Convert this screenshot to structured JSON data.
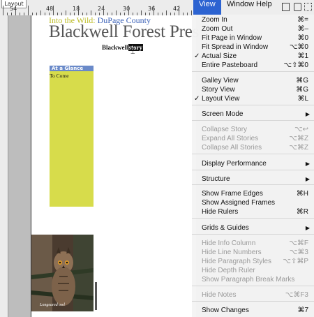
{
  "document": {
    "tab_label": "Layout",
    "ruler_numbers": [
      "54",
      "48",
      "18",
      "24",
      "30",
      "36",
      "42"
    ],
    "subhead_left": "Into the Wild:",
    "subhead_right": "DuPage County",
    "masthead": "Blackwell Forest Pres",
    "byline_text": "Blackwell",
    "byline_selected": "story",
    "sidebar_head": "At a Glance",
    "sidebar_body": "To Come",
    "photo_credit": "Longeared owl",
    "accent_colors": {
      "sidebar": "#d7dc4b",
      "sidebar_head": "#6a8ac9",
      "menu_highlight": "#2c63d1"
    }
  },
  "menubar": {
    "view": "View",
    "window": "Window",
    "help": "Help",
    "icons": [
      "document-icon",
      "script-icon",
      "layout-icon"
    ]
  },
  "menu": {
    "items": [
      {
        "label": "Zoom In",
        "shortcut": "⌘=",
        "disabled": false,
        "checked": false,
        "submenu": false
      },
      {
        "label": "Zoom Out",
        "shortcut": "⌘–",
        "disabled": false,
        "checked": false,
        "submenu": false
      },
      {
        "label": "Fit Page in Window",
        "shortcut": "⌘0",
        "disabled": false,
        "checked": false,
        "submenu": false
      },
      {
        "label": "Fit Spread in Window",
        "shortcut": "⌥⌘0",
        "disabled": false,
        "checked": false,
        "submenu": false
      },
      {
        "label": "Actual Size",
        "shortcut": "⌘1",
        "disabled": false,
        "checked": true,
        "submenu": false
      },
      {
        "label": "Entire Pasteboard",
        "shortcut": "⌥⇧⌘0",
        "disabled": false,
        "checked": false,
        "submenu": false
      },
      {
        "label": "Galley View",
        "shortcut": "⌘G",
        "disabled": false,
        "checked": false,
        "submenu": false
      },
      {
        "label": "Story View",
        "shortcut": "⌘G",
        "disabled": false,
        "checked": false,
        "submenu": false
      },
      {
        "label": "Layout View",
        "shortcut": "⌘L",
        "disabled": false,
        "checked": true,
        "submenu": false
      },
      {
        "label": "Screen Mode",
        "shortcut": "",
        "disabled": false,
        "checked": false,
        "submenu": true
      },
      {
        "label": "Collapse Story",
        "shortcut": "⌥↩",
        "disabled": true,
        "checked": false,
        "submenu": false
      },
      {
        "label": "Expand All Stories",
        "shortcut": "⌥⌘Z",
        "disabled": true,
        "checked": false,
        "submenu": false
      },
      {
        "label": "Collapse All Stories",
        "shortcut": "⌥⌘Z",
        "disabled": true,
        "checked": false,
        "submenu": false
      },
      {
        "label": "Display Performance",
        "shortcut": "",
        "disabled": false,
        "checked": false,
        "submenu": true
      },
      {
        "label": "Structure",
        "shortcut": "",
        "disabled": false,
        "checked": false,
        "submenu": true
      },
      {
        "label": "Show Frame Edges",
        "shortcut": "⌘H",
        "disabled": false,
        "checked": false,
        "submenu": false
      },
      {
        "label": "Show Assigned Frames",
        "shortcut": "",
        "disabled": false,
        "checked": false,
        "submenu": false
      },
      {
        "label": "Hide Rulers",
        "shortcut": "⌘R",
        "disabled": false,
        "checked": false,
        "submenu": false
      },
      {
        "label": "Grids & Guides",
        "shortcut": "",
        "disabled": false,
        "checked": false,
        "submenu": true
      },
      {
        "label": "Hide Info Column",
        "shortcut": "⌥⌘F",
        "disabled": true,
        "checked": false,
        "submenu": false
      },
      {
        "label": "Hide Line Numbers",
        "shortcut": "⌥⌘3",
        "disabled": true,
        "checked": false,
        "submenu": false
      },
      {
        "label": "Hide Paragraph Styles",
        "shortcut": "⌥⇧⌘P",
        "disabled": true,
        "checked": false,
        "submenu": false
      },
      {
        "label": "Hide Depth Ruler",
        "shortcut": "",
        "disabled": true,
        "checked": false,
        "submenu": false
      },
      {
        "label": "Show Paragraph Break Marks",
        "shortcut": "",
        "disabled": true,
        "checked": false,
        "submenu": false
      },
      {
        "label": "Hide Notes",
        "shortcut": "⌥⌘F3",
        "disabled": true,
        "checked": false,
        "submenu": false
      },
      {
        "label": "Show Changes",
        "shortcut": "⌘7",
        "disabled": false,
        "checked": false,
        "submenu": false
      }
    ]
  }
}
